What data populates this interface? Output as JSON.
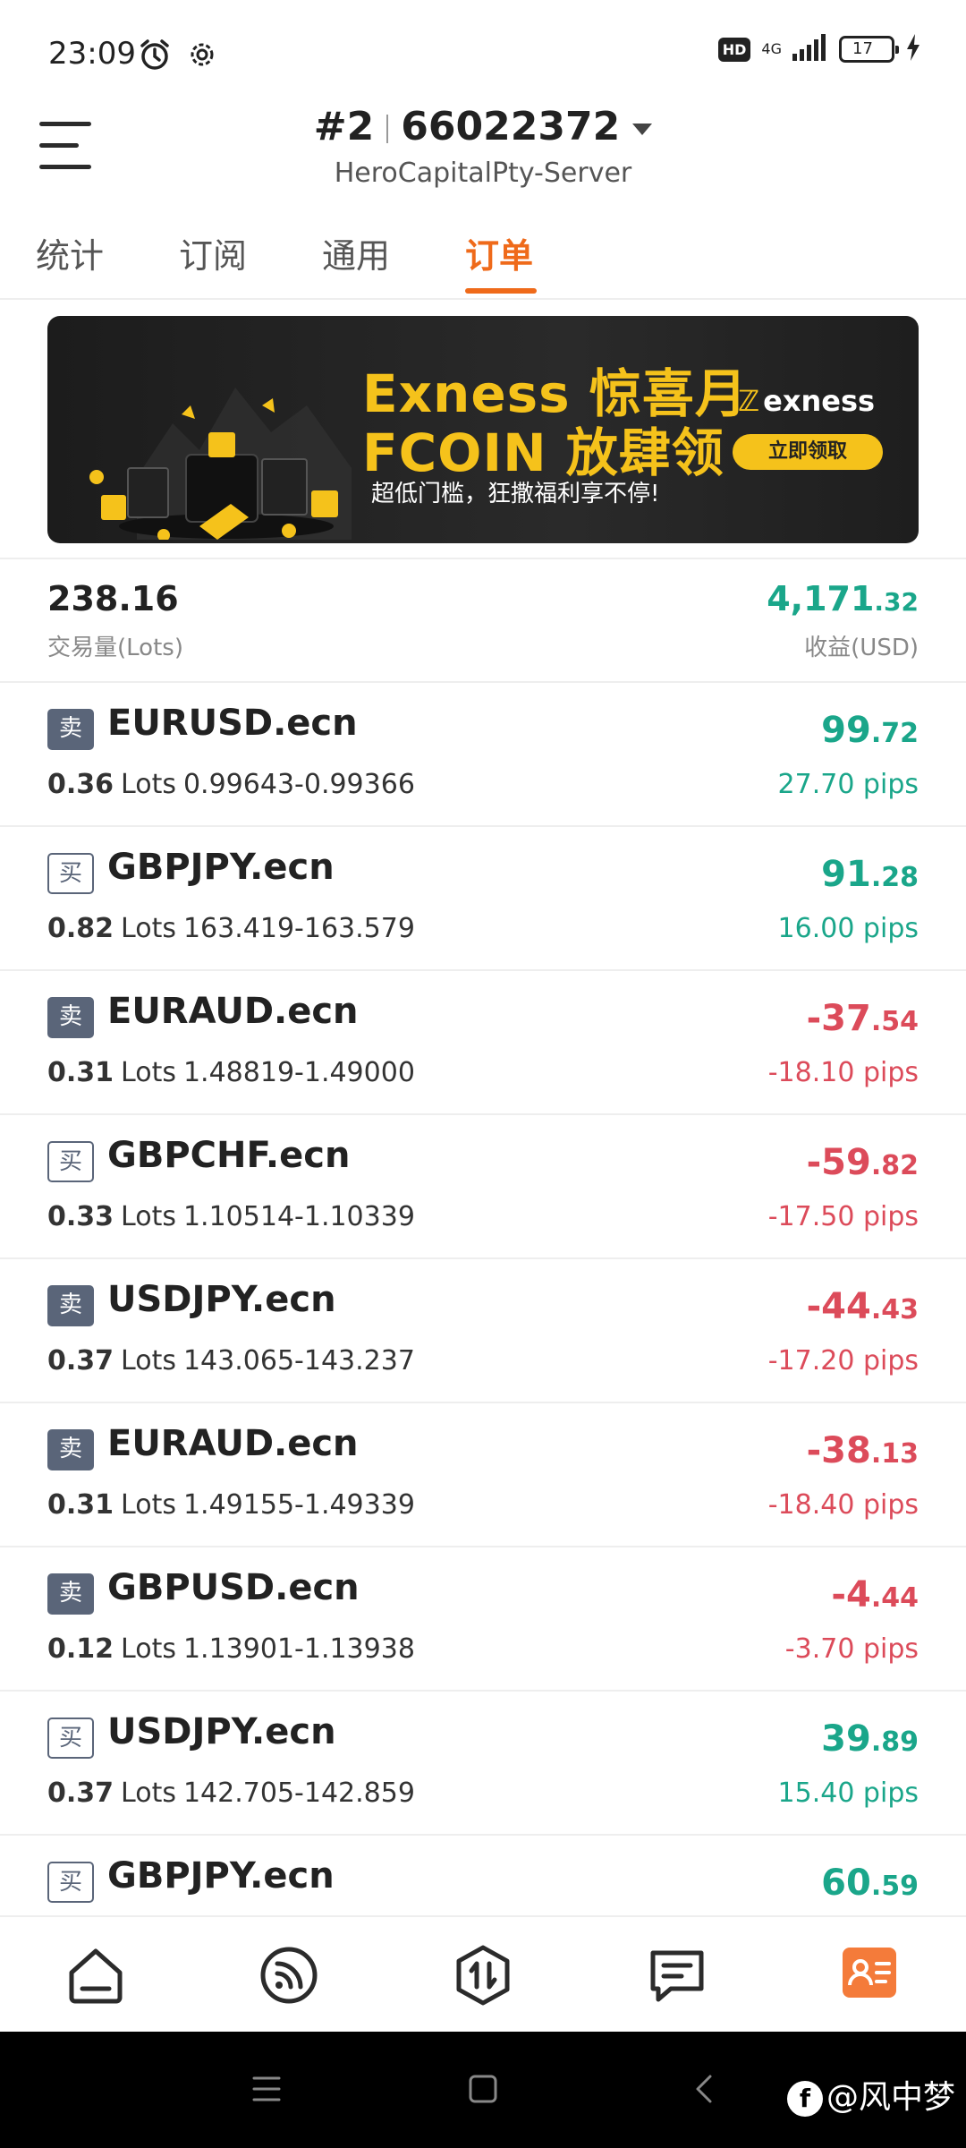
{
  "status_bar": {
    "time": "23:09",
    "hd": "HD",
    "network": "4G",
    "battery": "17",
    "battery_level": 0.17
  },
  "header": {
    "account_index": "#2",
    "account_number": "66022372",
    "server": "HeroCapitalPty-Server"
  },
  "tabs": [
    {
      "label": "统计",
      "active": false
    },
    {
      "label": "订阅",
      "active": false
    },
    {
      "label": "通用",
      "active": false
    },
    {
      "label": "订单",
      "active": true
    }
  ],
  "banner": {
    "title_line1": "Exness 惊喜月",
    "title_line2": "FCOIN 放肆领",
    "subtitle": "超低门槛，狂撒福利享不停!",
    "logo_text": "exness",
    "cta": "立即领取"
  },
  "summary": {
    "volume": "238.16",
    "volume_label": "交易量(Lots)",
    "profit_int": "4,171",
    "profit_dec": ".32",
    "profit_label": "收益(USD)"
  },
  "orders": [
    {
      "side": "卖",
      "type": "sell",
      "symbol": "EURUSD.ecn",
      "lots": "0.36",
      "lot_word": "Lots",
      "prices": "0.99643-0.99366",
      "profit_int": "99",
      "profit_dec": ".72",
      "pips": "27.70 pips",
      "positive": true
    },
    {
      "side": "买",
      "type": "buy",
      "symbol": "GBPJPY.ecn",
      "lots": "0.82",
      "lot_word": "Lots",
      "prices": "163.419-163.579",
      "profit_int": "91",
      "profit_dec": ".28",
      "pips": "16.00 pips",
      "positive": true
    },
    {
      "side": "卖",
      "type": "sell",
      "symbol": "EURAUD.ecn",
      "lots": "0.31",
      "lot_word": "Lots",
      "prices": "1.48819-1.49000",
      "profit_int": "-37",
      "profit_dec": ".54",
      "pips": "-18.10 pips",
      "positive": false
    },
    {
      "side": "买",
      "type": "buy",
      "symbol": "GBPCHF.ecn",
      "lots": "0.33",
      "lot_word": "Lots",
      "prices": "1.10514-1.10339",
      "profit_int": "-59",
      "profit_dec": ".82",
      "pips": "-17.50 pips",
      "positive": false
    },
    {
      "side": "卖",
      "type": "sell",
      "symbol": "USDJPY.ecn",
      "lots": "0.37",
      "lot_word": "Lots",
      "prices": "143.065-143.237",
      "profit_int": "-44",
      "profit_dec": ".43",
      "pips": "-17.20 pips",
      "positive": false
    },
    {
      "side": "卖",
      "type": "sell",
      "symbol": "EURAUD.ecn",
      "lots": "0.31",
      "lot_word": "Lots",
      "prices": "1.49155-1.49339",
      "profit_int": "-38",
      "profit_dec": ".13",
      "pips": "-18.40 pips",
      "positive": false
    },
    {
      "side": "卖",
      "type": "sell",
      "symbol": "GBPUSD.ecn",
      "lots": "0.12",
      "lot_word": "Lots",
      "prices": "1.13901-1.13938",
      "profit_int": "-4",
      "profit_dec": ".44",
      "pips": "-3.70 pips",
      "positive": false
    },
    {
      "side": "买",
      "type": "buy",
      "symbol": "USDJPY.ecn",
      "lots": "0.37",
      "lot_word": "Lots",
      "prices": "142.705-142.859",
      "profit_int": "39",
      "profit_dec": ".89",
      "pips": "15.40 pips",
      "positive": true
    },
    {
      "side": "买",
      "type": "buy",
      "symbol": "GBPJPY.ecn",
      "lots": "",
      "lot_word": "",
      "prices": "",
      "profit_int": "60",
      "profit_dec": ".59",
      "pips": "",
      "positive": true
    }
  ],
  "bottom_nav": [
    {
      "icon": "home-icon",
      "active": false
    },
    {
      "icon": "signal-icon",
      "active": false
    },
    {
      "icon": "trade-icon",
      "active": false
    },
    {
      "icon": "message-icon",
      "active": false
    },
    {
      "icon": "profile-card-icon",
      "active": true
    }
  ],
  "colors": {
    "accent": "#ef6a1a",
    "profit": "#1aa68a",
    "loss": "#dc4b5a",
    "banner_gold": "#f5c21b"
  },
  "watermark": "@风中梦"
}
